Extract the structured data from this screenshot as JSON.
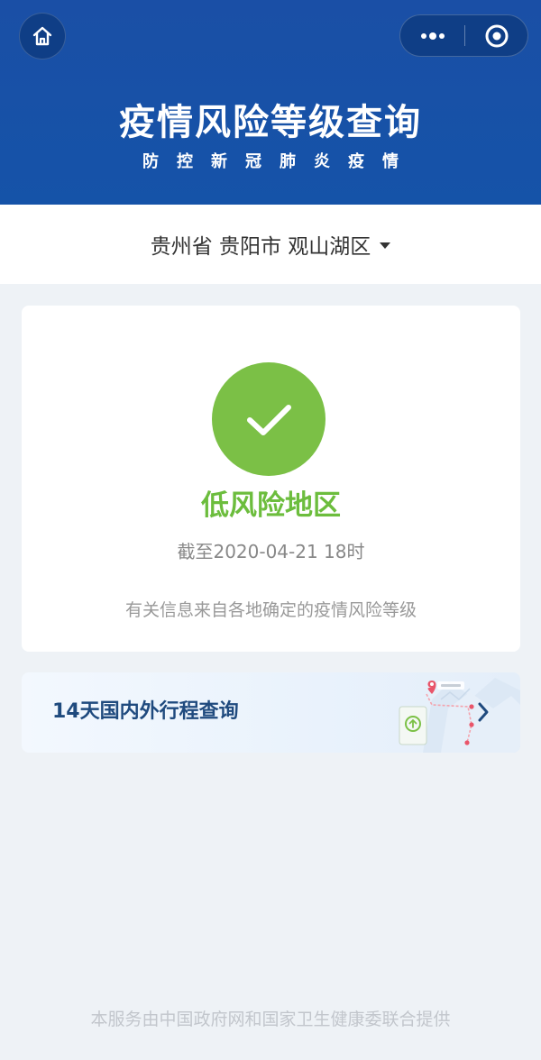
{
  "header": {
    "title": "疫情风险等级查询",
    "subtitle": "防控新冠肺炎疫情",
    "home_icon": "home-icon",
    "more_icon": "more-dots-icon",
    "close_icon": "target-close-icon",
    "background_color": "#1553a8"
  },
  "region": {
    "label": "贵州省 贵阳市 观山湖区",
    "dropdown_icon": "caret-down-icon"
  },
  "status": {
    "risk_level": "低风险地区",
    "as_of": "截至2020-04-21 18时",
    "note": "有关信息来自各地确定的疫情风险等级",
    "icon": "check-icon",
    "color": "#6cbd3d"
  },
  "trip": {
    "label": "14天国内外行程查询",
    "illustration": "route-map-illustration",
    "chevron_icon": "chevron-right-icon"
  },
  "footer": {
    "text": "本服务由中国政府网和国家卫生健康委联合提供"
  }
}
